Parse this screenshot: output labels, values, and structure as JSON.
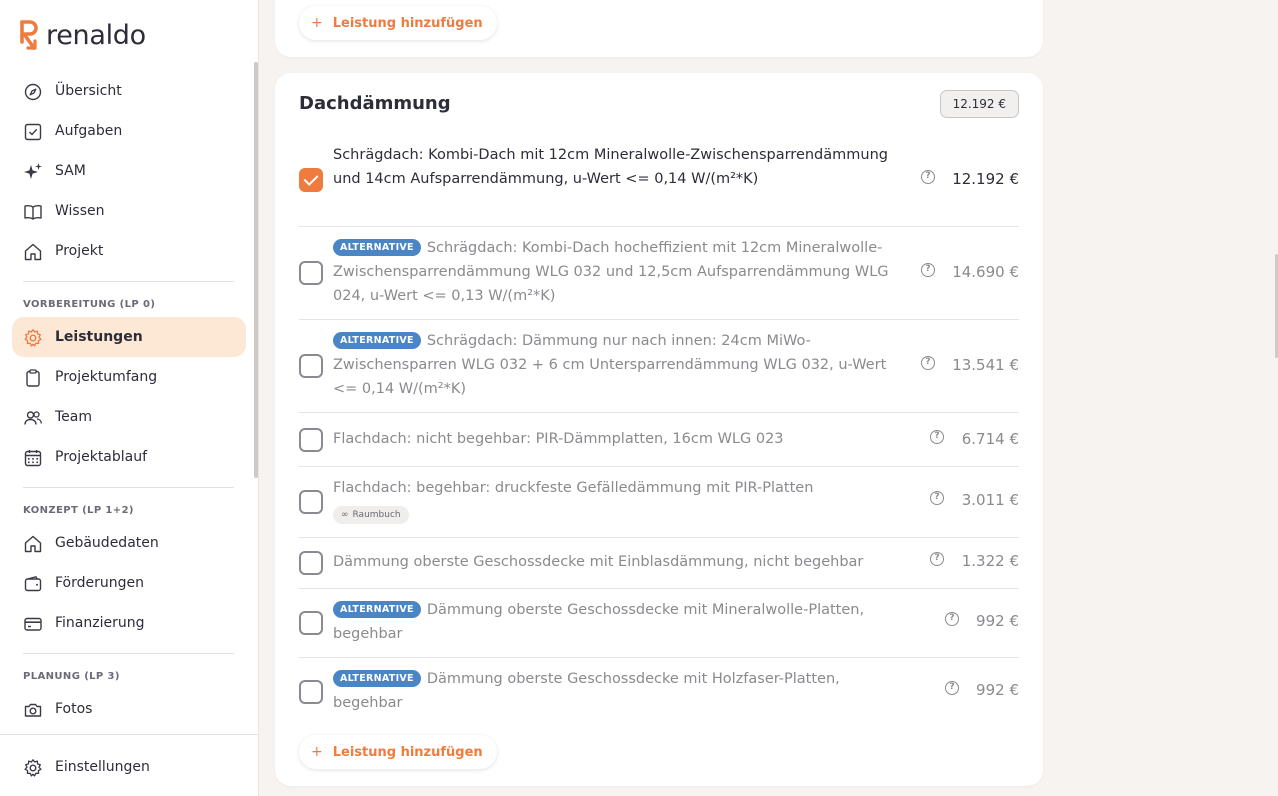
{
  "app": {
    "logo_text": "renaldo",
    "accent": "#f07b3f",
    "alt_badge_color": "#4a86c6"
  },
  "sidebar": {
    "top_items": [
      {
        "label": "Übersicht",
        "icon": "compass-icon"
      },
      {
        "label": "Aufgaben",
        "icon": "checkbox-icon"
      },
      {
        "label": "SAM",
        "icon": "sparkles-icon"
      },
      {
        "label": "Wissen",
        "icon": "book-icon"
      },
      {
        "label": "Projekt",
        "icon": "home-icon"
      }
    ],
    "section_vorbereitung": "VORBEREITUNG (LP 0)",
    "vorbereitung_items": [
      {
        "label": "Leistungen",
        "icon": "gear-icon",
        "active": true
      },
      {
        "label": "Projektumfang",
        "icon": "clipboard-icon"
      },
      {
        "label": "Team",
        "icon": "users-icon"
      },
      {
        "label": "Projektablauf",
        "icon": "calendar-icon"
      }
    ],
    "section_konzept": "KONZEPT (LP 1+2)",
    "konzept_items": [
      {
        "label": "Gebäudedaten",
        "icon": "home-icon"
      },
      {
        "label": "Förderungen",
        "icon": "wallet-icon"
      },
      {
        "label": "Finanzierung",
        "icon": "credit-card-icon"
      }
    ],
    "section_planung": "PLANUNG (LP 3)",
    "planung_items": [
      {
        "label": "Fotos",
        "icon": "camera-icon"
      }
    ],
    "settings_label": "Einstellungen"
  },
  "main": {
    "add_service_label": "Leistung hinzufügen",
    "card": {
      "title": "Dachdämmung",
      "total": "12.192 €",
      "rows": [
        {
          "checked": true,
          "alternative": false,
          "text": "Schrägdach: Kombi-Dach mit 12cm Mineralwolle-Zwischensparrendämmung und 14cm Aufsparrendämmung, u-Wert <= 0,14 W/(m²*K)",
          "price": "12.192 €"
        },
        {
          "checked": false,
          "alternative": true,
          "text": "Schrägdach: Kombi-Dach hocheffizient mit 12cm Mineralwolle-Zwischensparrendämmung WLG 032 und 12,5cm Aufsparrendämmung WLG 024, u-Wert <= 0,13 W/(m²*K)",
          "price": "14.690 €"
        },
        {
          "checked": false,
          "alternative": true,
          "text": "Schrägdach: Dämmung nur nach innen: 24cm MiWo-Zwischensparren WLG 032 + 6 cm Untersparrendämmung WLG 032, u-Wert <= 0,14 W/(m²*K)",
          "price": "13.541 €"
        },
        {
          "checked": false,
          "alternative": false,
          "text": "Flachdach: nicht begehbar: PIR-Dämmplatten, 16cm WLG 023",
          "price": "6.714 €"
        },
        {
          "checked": false,
          "alternative": false,
          "text": "Flachdach: begehbar: druckfeste Gefälledämmung mit PIR-Platten",
          "tag": "Raumbuch",
          "price": "3.011 €"
        },
        {
          "checked": false,
          "alternative": false,
          "text": "Dämmung oberste Geschossdecke mit Einblasdämmung, nicht begehbar",
          "price": "1.322 €"
        },
        {
          "checked": false,
          "alternative": true,
          "text": "Dämmung oberste Geschossdecke mit Mineralwolle-Platten, begehbar",
          "price": "992 €"
        },
        {
          "checked": false,
          "alternative": true,
          "text": "Dämmung oberste Geschossdecke mit Holzfaser-Platten, begehbar",
          "price": "992 €"
        }
      ]
    },
    "alternative_label": "ALTERNATIVE"
  }
}
